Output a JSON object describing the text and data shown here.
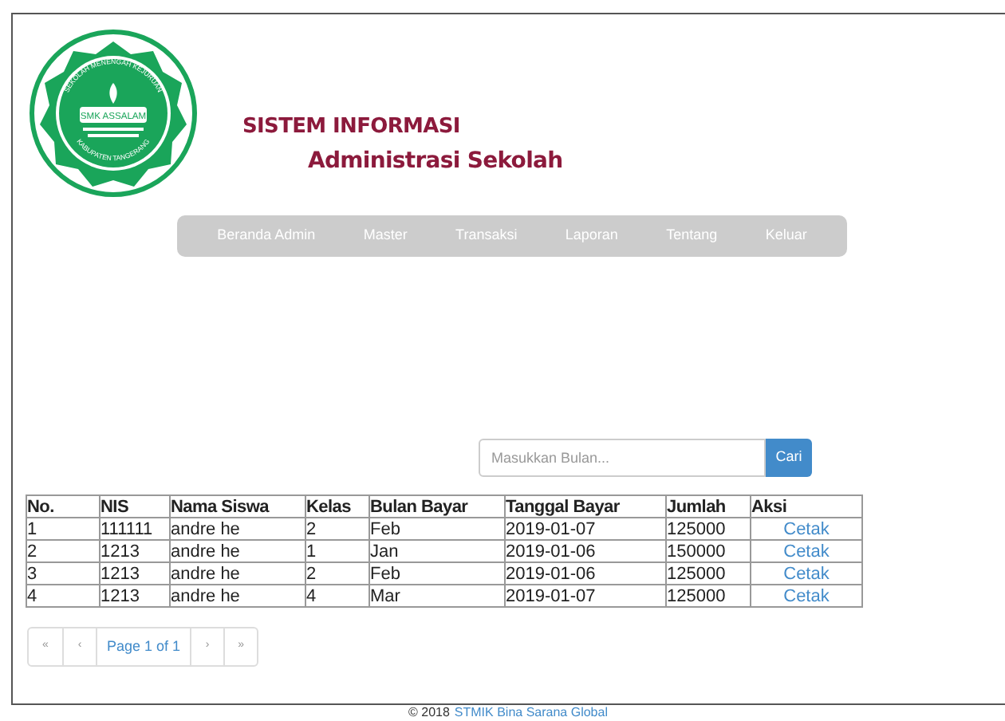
{
  "logo": {
    "top_text": "SEKOLAH MENENGAH KEJURUAN",
    "name": "SMK ASSALAM",
    "bottom_text": "KABUPATEN TANGERANG"
  },
  "header": {
    "title": "SISTEM INFORMASI",
    "subtitle": "Administrasi Sekolah"
  },
  "nav": [
    "Beranda Admin",
    "Master",
    "Transaksi",
    "Laporan",
    "Tentang",
    "Keluar"
  ],
  "search": {
    "placeholder": "Masukkan Bulan...",
    "button": "Cari"
  },
  "table": {
    "columns": [
      "No.",
      "NIS",
      "Nama Siswa",
      "Kelas",
      "Bulan Bayar",
      "Tanggal Bayar",
      "Jumlah",
      "Aksi"
    ],
    "rows": [
      {
        "cells": [
          "1",
          "111111",
          "andre he",
          "2",
          "Feb",
          "2019-01-07",
          "125000"
        ],
        "action": "Cetak"
      },
      {
        "cells": [
          "2",
          "1213",
          "andre he",
          "1",
          "Jan",
          "2019-01-06",
          "150000"
        ],
        "action": "Cetak"
      },
      {
        "cells": [
          "3",
          "1213",
          "andre he",
          "2",
          "Feb",
          "2019-01-06",
          "125000"
        ],
        "action": "Cetak"
      },
      {
        "cells": [
          "4",
          "1213",
          "andre he",
          "4",
          "Mar",
          "2019-01-07",
          "125000"
        ],
        "action": "Cetak"
      }
    ]
  },
  "pagination": [
    {
      "label": "«",
      "kind": "nav"
    },
    {
      "label": "‹",
      "kind": "nav"
    },
    {
      "label": "Page 1 of 1",
      "kind": "info"
    },
    {
      "label": "›",
      "kind": "nav"
    },
    {
      "label": "»",
      "kind": "nav"
    }
  ],
  "footer": {
    "copyright": "© 2018",
    "link": "STMIK Bina Sarana Global"
  }
}
